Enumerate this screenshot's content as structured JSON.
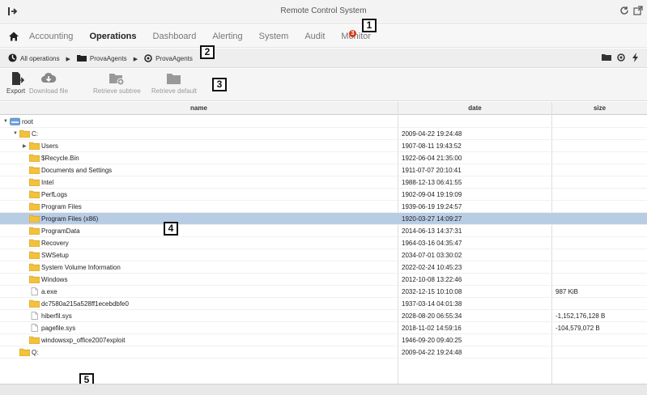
{
  "window": {
    "title": "Remote Control System"
  },
  "menu": {
    "items": [
      "Accounting",
      "Operations",
      "Dashboard",
      "Alerting",
      "System",
      "Audit",
      "Monitor"
    ],
    "active": "Operations",
    "monitor_badge": "3"
  },
  "breadcrumb": {
    "items": [
      "All operations",
      "ProvaAgents",
      "ProvaAgents"
    ]
  },
  "toolbar": {
    "export": "Export",
    "download": "Download file",
    "retrieve_subtree": "Retrieve subtree",
    "retrieve_default": "Retrieve default"
  },
  "grid": {
    "columns": {
      "name": "name",
      "date": "date",
      "size": "size"
    },
    "rows": [
      {
        "name": "root",
        "date": "",
        "size": "",
        "depth": 0,
        "type": "drive",
        "arrow": "▼"
      },
      {
        "name": "C:",
        "date": "2009-04-22 19:24:48",
        "size": "",
        "depth": 1,
        "type": "folder",
        "arrow": "▼"
      },
      {
        "name": "Users",
        "date": "1907-08-11 19:43:52",
        "size": "",
        "depth": 2,
        "type": "folder",
        "arrow": "▶"
      },
      {
        "name": "$Recycle.Bin",
        "date": "1922-06-04 21:35:00",
        "size": "",
        "depth": 2,
        "type": "folder",
        "arrow": ""
      },
      {
        "name": "Documents and Settings",
        "date": "1911-07-07 20:10:41",
        "size": "",
        "depth": 2,
        "type": "folder",
        "arrow": ""
      },
      {
        "name": "Intel",
        "date": "1988-12-13 06:41:55",
        "size": "",
        "depth": 2,
        "type": "folder",
        "arrow": ""
      },
      {
        "name": "PerfLogs",
        "date": "1902-09-04 19:19:09",
        "size": "",
        "depth": 2,
        "type": "folder",
        "arrow": ""
      },
      {
        "name": "Program Files",
        "date": "1939-06-19 19:24:57",
        "size": "",
        "depth": 2,
        "type": "folder",
        "arrow": ""
      },
      {
        "name": "Program Files (x86)",
        "date": "1920-03-27 14:09:27",
        "size": "",
        "depth": 2,
        "type": "folder",
        "arrow": "",
        "selected": true
      },
      {
        "name": "ProgramData",
        "date": "2014-06-13 14:37:31",
        "size": "",
        "depth": 2,
        "type": "folder",
        "arrow": ""
      },
      {
        "name": "Recovery",
        "date": "1964-03-16 04:35:47",
        "size": "",
        "depth": 2,
        "type": "folder",
        "arrow": ""
      },
      {
        "name": "SWSetup",
        "date": "2034-07-01 03:30:02",
        "size": "",
        "depth": 2,
        "type": "folder",
        "arrow": ""
      },
      {
        "name": "System Volume Information",
        "date": "2022-02-24 10:45:23",
        "size": "",
        "depth": 2,
        "type": "folder",
        "arrow": ""
      },
      {
        "name": "Windows",
        "date": "2012-10-08 13:22:46",
        "size": "",
        "depth": 2,
        "type": "folder",
        "arrow": ""
      },
      {
        "name": "a.exe",
        "date": "2032-12-15 10:10:08",
        "size": "987 KiB",
        "depth": 2,
        "type": "file",
        "arrow": ""
      },
      {
        "name": "dc7580a215a528ff1ecebdbfe0",
        "date": "1937-03-14 04:01:38",
        "size": "",
        "depth": 2,
        "type": "folder",
        "arrow": ""
      },
      {
        "name": "hiberfil.sys",
        "date": "2028-08-20 06:55:34",
        "size": "-1,152,176,128 B",
        "depth": 2,
        "type": "file",
        "arrow": ""
      },
      {
        "name": "pagefile.sys",
        "date": "2018-11-02 14:59:16",
        "size": "-104,579,072 B",
        "depth": 2,
        "type": "file",
        "arrow": ""
      },
      {
        "name": "windowsxp_office2007exploit",
        "date": "1946-09-20 09:40:25",
        "size": "",
        "depth": 2,
        "type": "folder",
        "arrow": ""
      },
      {
        "name": "Q:",
        "date": "2009-04-22 19:24:48",
        "size": "",
        "depth": 1,
        "type": "folder",
        "arrow": ""
      }
    ]
  },
  "callouts": [
    "1",
    "2",
    "3",
    "4",
    "5"
  ],
  "colors": {
    "selection": "#b8cce4",
    "folder": "#f3c13a",
    "badge": "#d9381e"
  }
}
